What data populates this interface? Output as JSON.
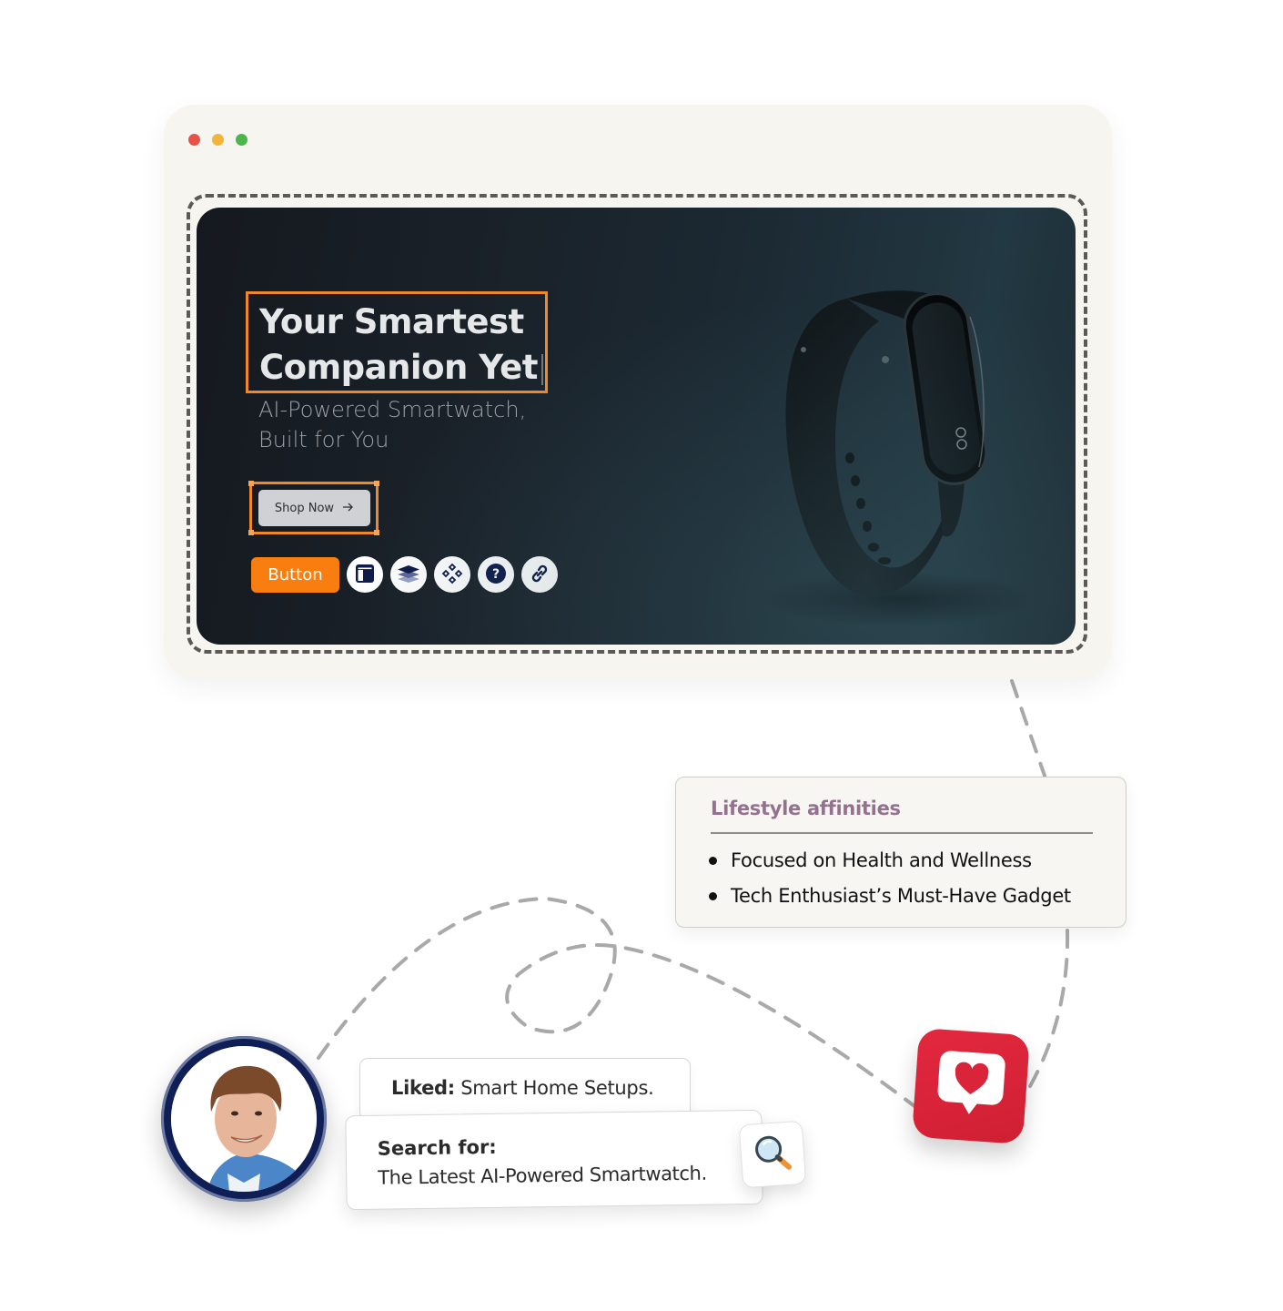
{
  "window": {
    "controls": [
      "close",
      "minimize",
      "maximize"
    ],
    "colors": {
      "close": "#e5534b",
      "minimize": "#f0b53a",
      "maximize": "#4cb54c"
    }
  },
  "hero": {
    "headline_line1": "Your Smartest",
    "headline_line2": "Companion Yet",
    "subtitle_line1": "AI-Powered Smartwatch,",
    "subtitle_line2": "Built for You",
    "cta_label": "Shop Now",
    "cta_icon": "arrow-right-icon",
    "image": "fitness-band-watch",
    "selection_color": "#f0882a"
  },
  "toolbar": {
    "button_label": "Button",
    "button_color": "#f77e0f",
    "icons": [
      "layout-icon",
      "layers-icon",
      "components-icon",
      "help-icon",
      "link-icon"
    ]
  },
  "lifestyle": {
    "title": "Lifestyle affinities",
    "title_color": "#94728f",
    "items": [
      "Focused on Health and Wellness",
      "Tech Enthusiast’s Must-Have Gadget"
    ]
  },
  "profile": {
    "avatar": "user-avatar",
    "liked_label": "Liked:",
    "liked_value": "Smart Home Setups.",
    "search_label": "Search for:",
    "search_value": "The Latest AI-Powered Smartwatch."
  },
  "icons": {
    "search_tile": "magnifier-icon",
    "heart_tile": "heart-chat-icon",
    "heart_color": "#d9243a"
  }
}
